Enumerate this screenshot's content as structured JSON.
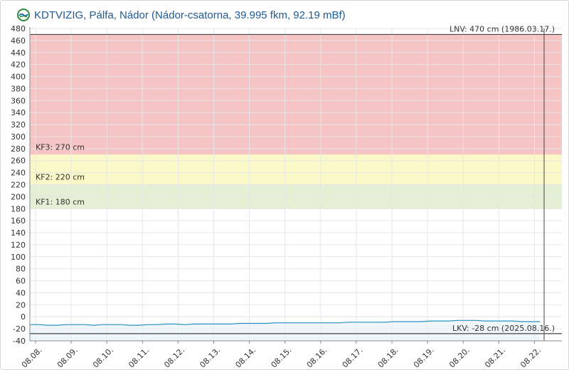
{
  "header": {
    "logo_icon": "kdtvizig-logo-icon",
    "title": "KDTVIZIG, Pálfa, Nádor (Nádor-csatorna, 39.995 fkm, 92.19 mBf)"
  },
  "colors": {
    "band_kf3": "#f6c4c4",
    "band_kf2": "#fbf8c8",
    "band_kf1": "#e4efd4",
    "series": "#2a8fc0",
    "reference_line": "#444444",
    "grid": "#e6e6e6"
  },
  "chart_data": {
    "type": "line",
    "ylim": [
      -40,
      480
    ],
    "yticks": [
      480,
      460,
      440,
      420,
      400,
      380,
      360,
      340,
      320,
      300,
      280,
      260,
      240,
      220,
      200,
      180,
      160,
      140,
      120,
      100,
      80,
      60,
      40,
      20,
      0,
      -20,
      -40
    ],
    "xtick_labels": [
      "08.08.",
      "08.09.",
      "08.10.",
      "08.11.",
      "08.12.",
      "08.13.",
      "08.14.",
      "08.15.",
      "08.16.",
      "08.17.",
      "08.18.",
      "08.19.",
      "08.20.",
      "08.21.",
      "08.22."
    ],
    "grid": true,
    "bands": [
      {
        "name": "KF3",
        "from": 270,
        "to": 470,
        "label": "KF3: 270 cm"
      },
      {
        "name": "KF2",
        "from": 220,
        "to": 270,
        "label": "KF2: 220 cm"
      },
      {
        "name": "KF1",
        "from": 180,
        "to": 220,
        "label": "KF1: 180 cm"
      }
    ],
    "reference_lines": [
      {
        "value": 470,
        "label": "LNV: 470 cm (1986.03.17.)"
      },
      {
        "value": -28,
        "label": "LKV: -28 cm (2025.08.16.)"
      }
    ],
    "series": [
      {
        "x": [
          0,
          0.25,
          0.5,
          0.75,
          1,
          1.25,
          1.5,
          1.75,
          2,
          2.25,
          2.5,
          2.75,
          3,
          3.25,
          3.5,
          3.75,
          4,
          4.25,
          4.5,
          4.75,
          5,
          5.25,
          5.5,
          5.75,
          6,
          6.25,
          6.5,
          6.75,
          7,
          7.25,
          7.5,
          7.75,
          8,
          8.25,
          8.5,
          8.75,
          9,
          9.25,
          9.5,
          9.75,
          10,
          10.25,
          10.5,
          10.75,
          11,
          11.25,
          11.5,
          11.75,
          12,
          12.25,
          12.5,
          12.75,
          13,
          13.25,
          13.5,
          13.75,
          14
        ],
        "values": [
          -13,
          -13,
          -14,
          -14,
          -13,
          -13,
          -13,
          -14,
          -13,
          -13,
          -13,
          -14,
          -14,
          -13,
          -13,
          -12,
          -12,
          -13,
          -12,
          -12,
          -12,
          -12,
          -12,
          -11,
          -11,
          -11,
          -11,
          -10,
          -10,
          -10,
          -10,
          -10,
          -10,
          -10,
          -10,
          -9,
          -9,
          -9,
          -9,
          -9,
          -8,
          -8,
          -8,
          -8,
          -7,
          -7,
          -7,
          -6,
          -6,
          -6,
          -7,
          -7,
          -7,
          -7,
          -8,
          -8,
          -8
        ]
      }
    ]
  }
}
